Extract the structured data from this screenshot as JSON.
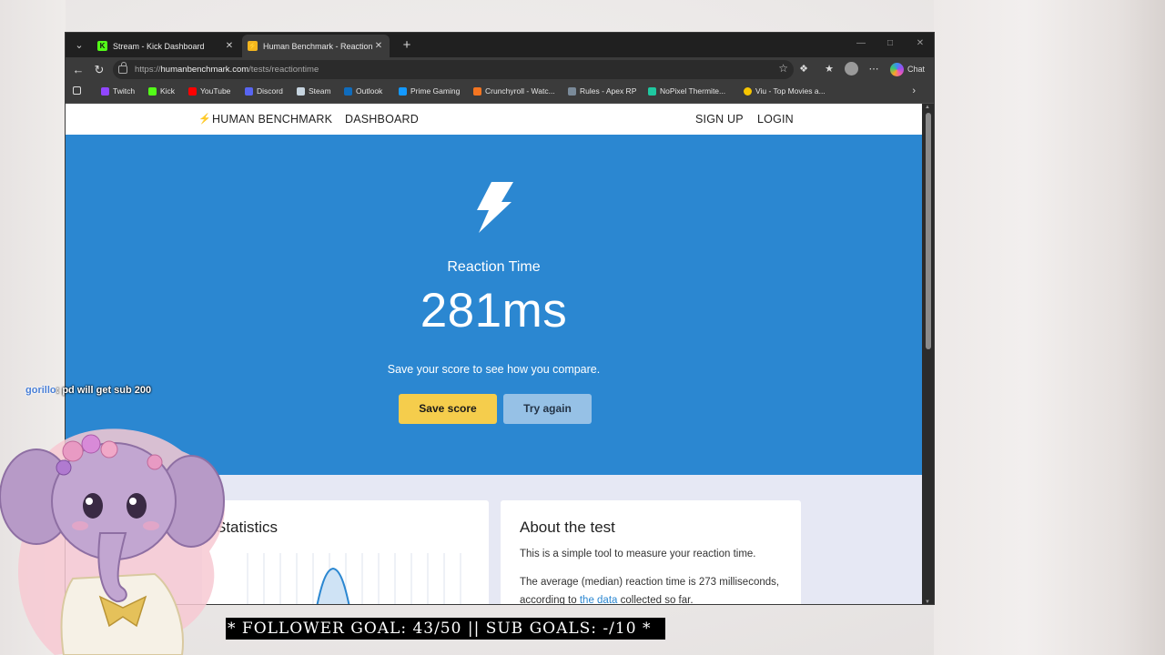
{
  "browser": {
    "tabs": [
      {
        "title": "Stream - Kick Dashboard",
        "favicon": "kick-icon",
        "active": false
      },
      {
        "title": "Human Benchmark - Reaction Time",
        "favicon": "humanbenchmark-icon",
        "active": true
      }
    ],
    "address": {
      "scheme": "https://",
      "host": "humanbenchmark.com",
      "path": "/tests/reactiontime"
    },
    "copilot_label": "Chat",
    "bookmarks": [
      {
        "label": "Twitch",
        "color": "#9146ff"
      },
      {
        "label": "Kick",
        "color": "#53fc18"
      },
      {
        "label": "YouTube",
        "color": "#ff0000"
      },
      {
        "label": "Discord",
        "color": "#5865f2"
      },
      {
        "label": "Steam",
        "color": "#c7d5e0"
      },
      {
        "label": "Outlook",
        "color": "#0f6cbd"
      },
      {
        "label": "Prime Gaming",
        "color": "#1399ff"
      },
      {
        "label": "Crunchyroll - Watc...",
        "color": "#f47521"
      },
      {
        "label": "Rules - Apex RP",
        "color": "#7a8a99"
      },
      {
        "label": "NoPixel Thermite...",
        "color": "#1fc8a0"
      },
      {
        "label": "Viu - Top Movies a...",
        "color": "#f6c500"
      }
    ]
  },
  "site": {
    "nav": {
      "brand": "HUMAN BENCHMARK",
      "dashboard": "DASHBOARD",
      "signup": "SIGN UP",
      "login": "LOGIN"
    },
    "hero": {
      "test_name": "Reaction Time",
      "result": "281ms",
      "prompt": "Save your score to see how you compare.",
      "save_label": "Save score",
      "retry_label": "Try again"
    },
    "stats_card": {
      "title": "Statistics"
    },
    "about_card": {
      "title": "About the test",
      "line1": "This is a simple tool to measure your reaction time.",
      "line2_prefix": "The average (median) reaction time is 273 milliseconds, according to ",
      "line2_link": "the data",
      "line2_suffix": " collected so far."
    }
  },
  "overlay": {
    "chat_user": "gorillo",
    "chat_message": ": pd will get sub 200",
    "goal_text": "* FOLLOWER GOAL: 43/50 || SUB GOALS: -/10 *"
  },
  "colors": {
    "hero_bg": "#2b87d1",
    "save_button": "#f5cd4c",
    "retry_button": "#96c1e6",
    "page_bg": "#e6e8f4"
  }
}
